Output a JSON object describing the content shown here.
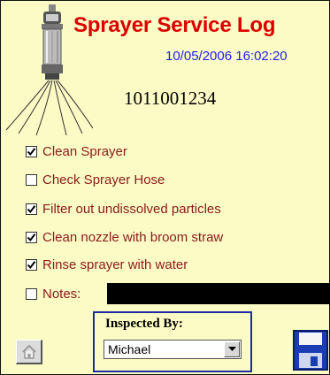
{
  "header": {
    "title": "Sprayer Service Log",
    "datetime": "10/05/2006 16:02:20",
    "serial": "1011001234"
  },
  "tasks": [
    {
      "label": "Clean Sprayer",
      "checked": true
    },
    {
      "label": "Check Sprayer Hose",
      "checked": false
    },
    {
      "label": "Filter out undissolved particles",
      "checked": true
    },
    {
      "label": "Clean nozzle with broom straw",
      "checked": true
    },
    {
      "label": "Rinse sprayer with water",
      "checked": true
    }
  ],
  "notes": {
    "label": "Notes:",
    "checked": false,
    "value": ""
  },
  "inspector": {
    "label": "Inspected By:",
    "selected": "Michael"
  },
  "colors": {
    "background": "#fbfbc5",
    "title": "#dd0000",
    "datetime": "#1d1df0",
    "task_label": "#8b1a1a",
    "inspector_border": "#1f2a9e"
  },
  "icons": {
    "home": "home-icon",
    "save": "floppy-disk-icon",
    "sprayer": "sprayer-nozzle-icon",
    "dropdown": "chevron-down-icon"
  }
}
